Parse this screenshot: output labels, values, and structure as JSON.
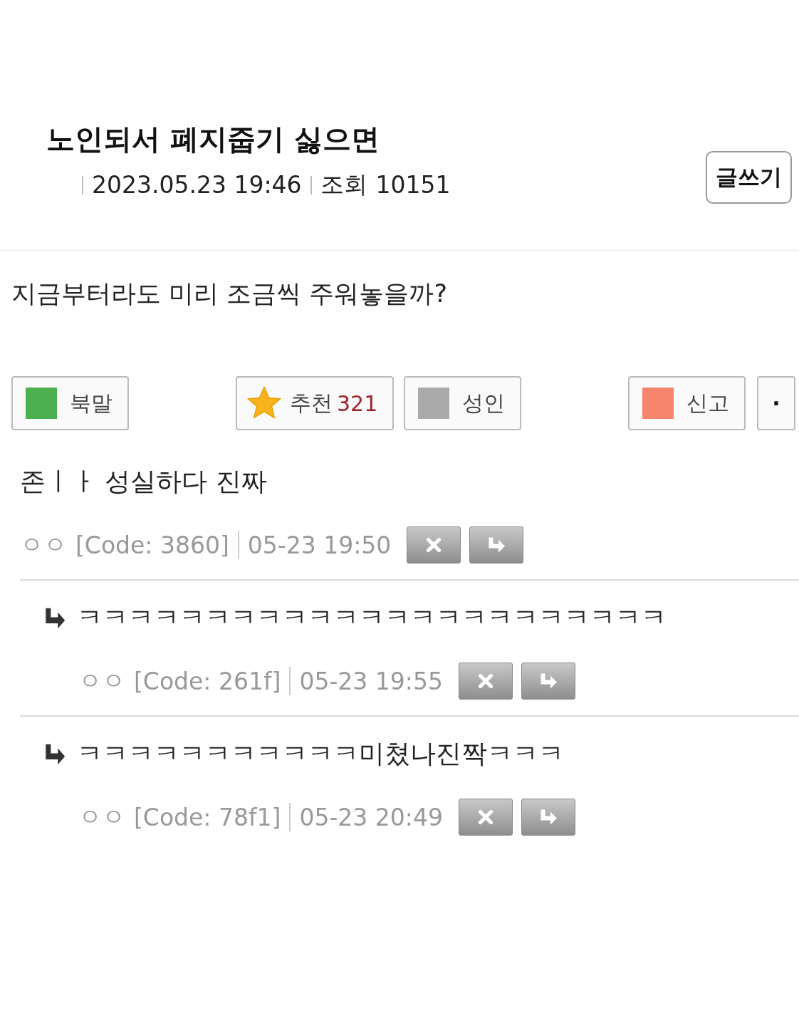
{
  "post": {
    "title": "노인되서 폐지줍기 싫으면",
    "date": "2023.05.23 19:46",
    "views_label": "조회",
    "views": "10151",
    "write_button": "글쓰기",
    "body": "지금부터라도 미리 조금씩 주워놓을까?"
  },
  "actions": [
    {
      "kind": "square",
      "label": "북말",
      "color": "#4caf50"
    },
    {
      "kind": "star",
      "label": "추천",
      "count": "321"
    },
    {
      "kind": "square",
      "label": "성인",
      "color": "#aaaaaa"
    },
    {
      "kind": "square",
      "label": "신고",
      "color": "#f4846c"
    },
    {
      "kind": "dot",
      "label": "·"
    }
  ],
  "comments": [
    {
      "reply": false,
      "text": "존ㅣㅏ 성실하다 진짜",
      "nick": "ㅇㅇ",
      "code": "[Code: 3860]",
      "time": "05-23 19:50"
    },
    {
      "reply": true,
      "text": "ㅋㅋㅋㅋㅋㅋㅋㅋㅋㅋㅋㅋㅋㅋㅋㅋㅋㅋㅋㅋㅋㅋㅋ",
      "nick": "ㅇㅇ",
      "code": "[Code: 261f]",
      "time": "05-23 19:55"
    },
    {
      "reply": true,
      "text": "ㅋㅋㅋㅋㅋㅋㅋㅋㅋㅋㅋ미쳤나진짝ㅋㅋㅋ",
      "nick": "ㅇㅇ",
      "code": "[Code: 78f1]",
      "time": "05-23 20:49"
    }
  ]
}
